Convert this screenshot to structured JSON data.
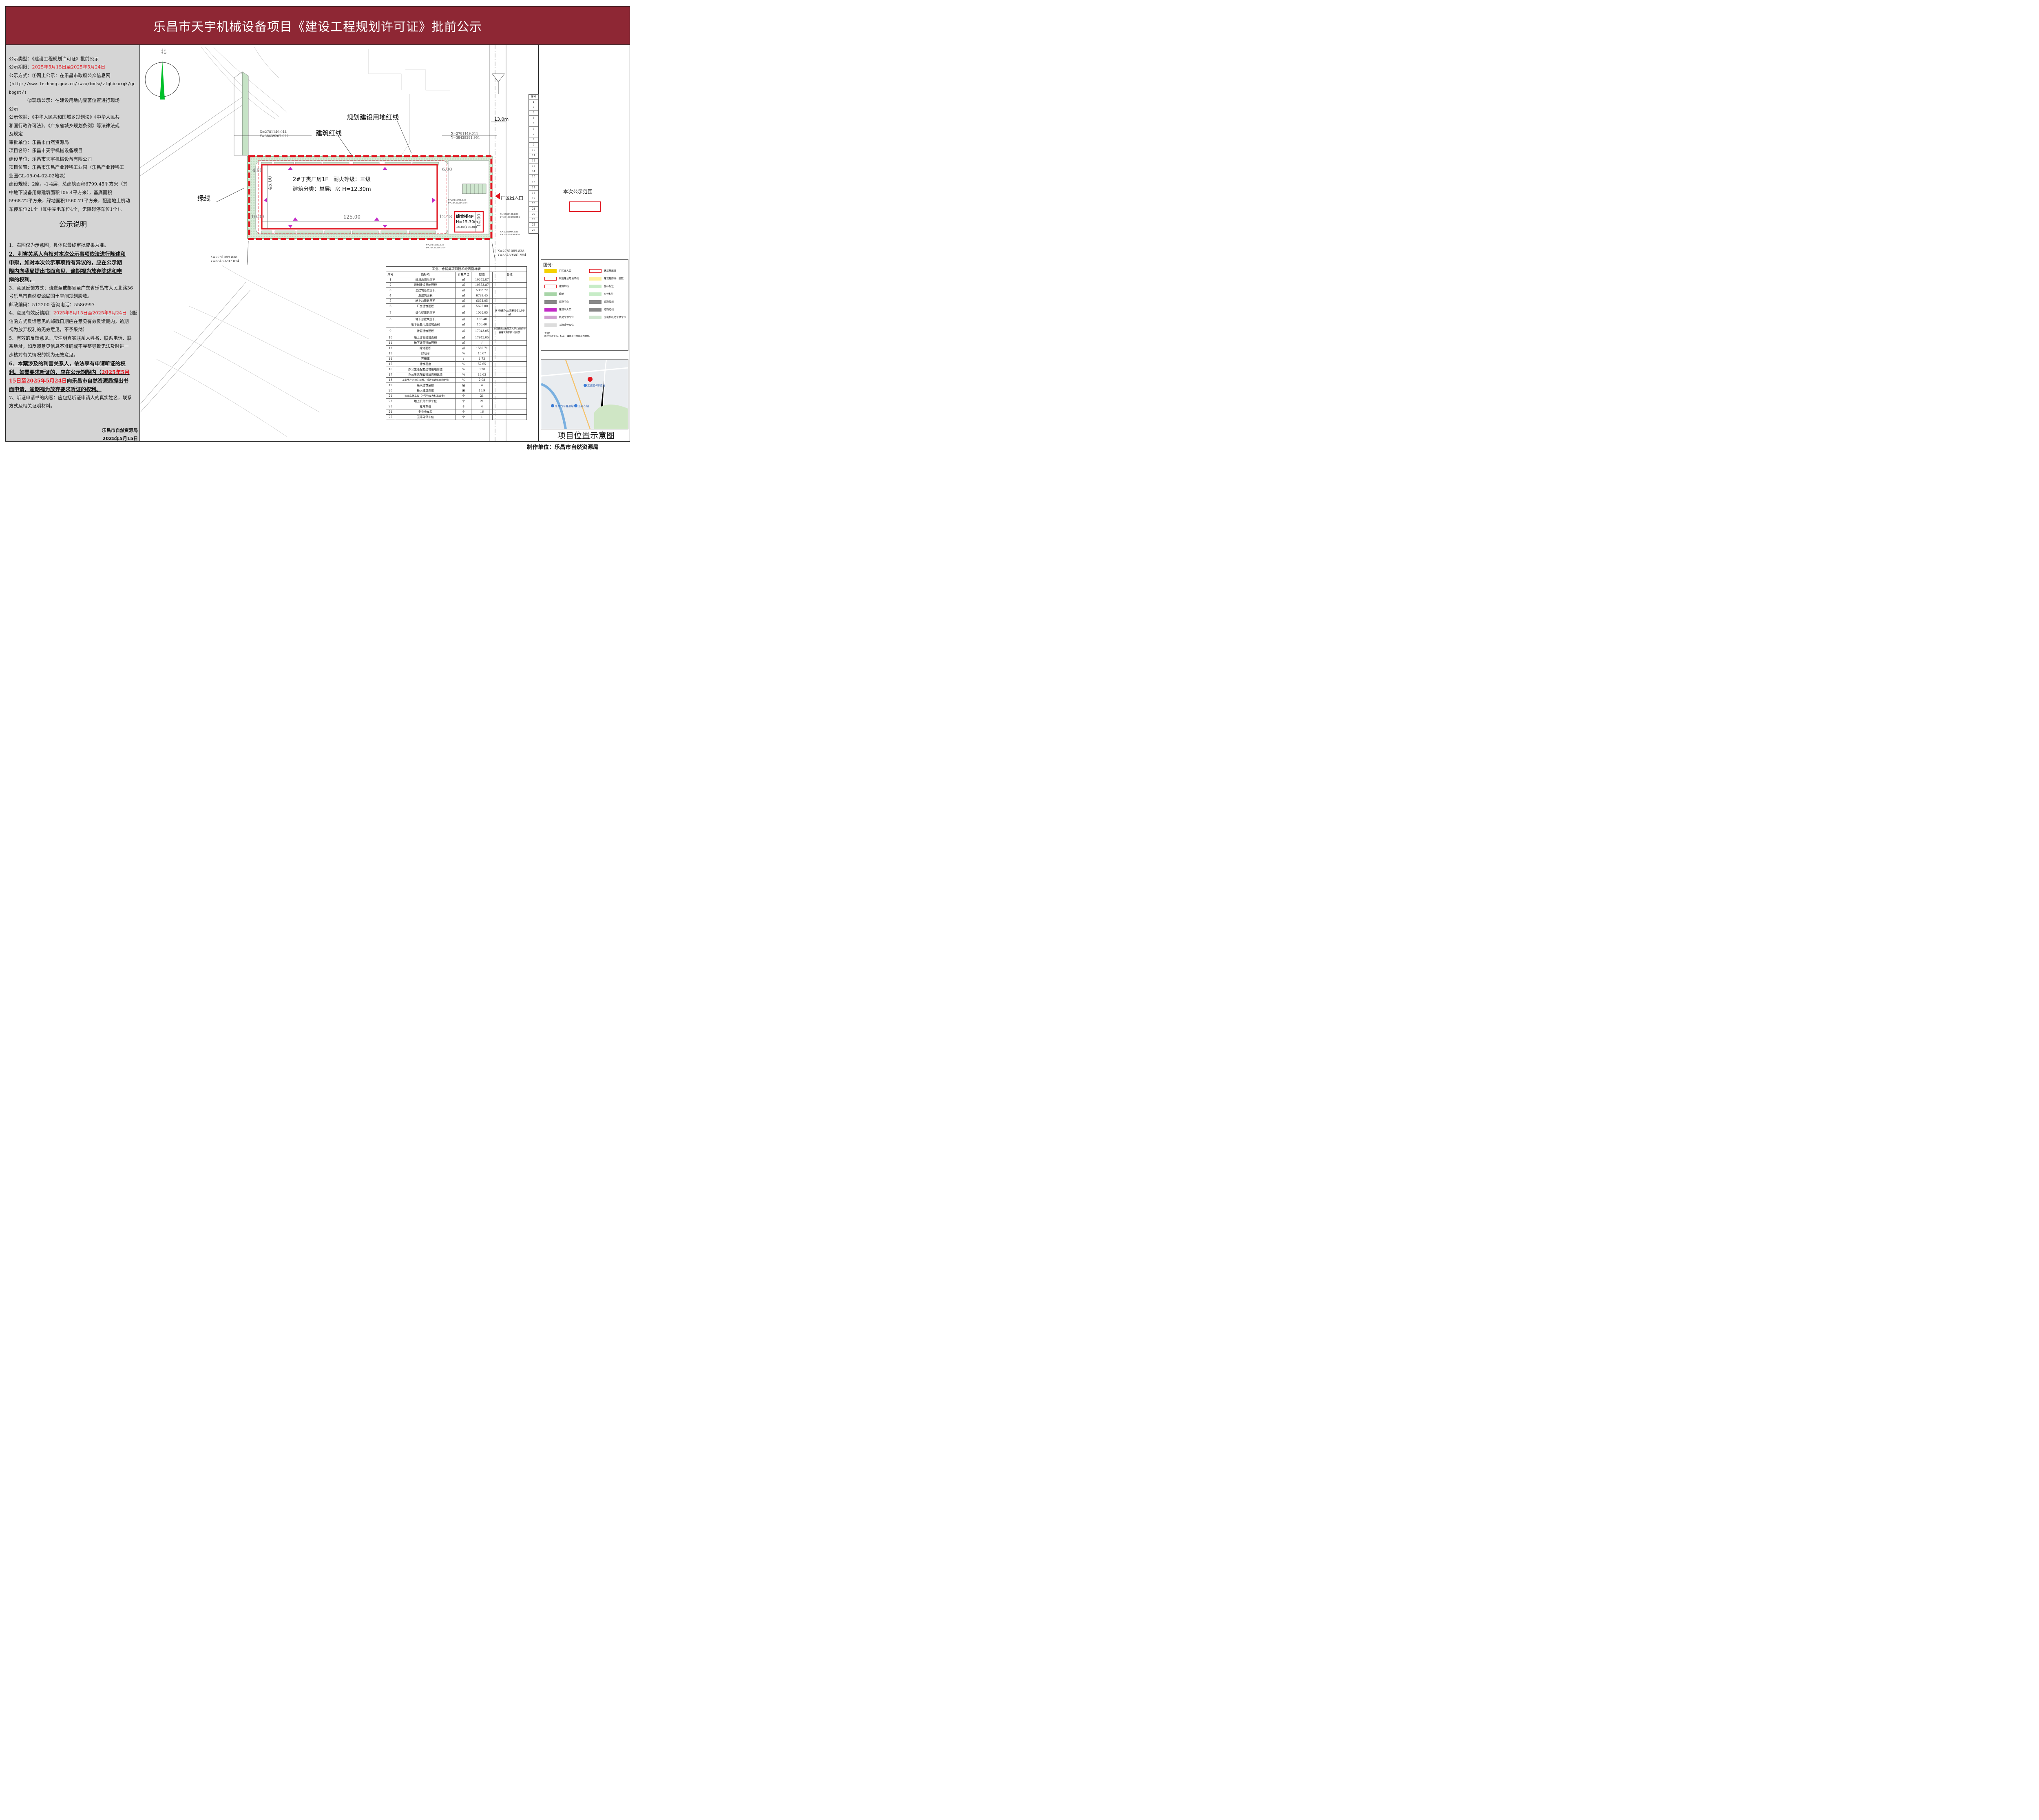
{
  "title": "乐昌市天宇机械设备项目《建设工程规划许可证》批前公示",
  "left_panel": {
    "lines": [
      "公示类型：《建设工程规划许可证》批前公示",
      "公示期限：",
      "公示方式：①网上公示：在乐昌市政府公众信息网",
      "(http://www.lechang.gov.cn/xwzx/bmfw/zfghbzxxgk/gc",
      "bpgst/)",
      "　　　　②现场公示：在建设用地内显著位置进行现场",
      "公示",
      "公示依据：《中华人民共和国城乡规划法》《中华人民共",
      "和国行政许可法》、《广东省城乡规划条例》等法律法规",
      "及规定",
      "审批单位：乐昌市自然资源局",
      "项目名称：乐昌市天宇机械设备项目",
      "建设单位：乐昌市天宇机械设备有限公司",
      "项目位置：乐昌市乐昌产业转移工业园（乐昌产业转移工",
      "业园GL-05-04-02-02地块）",
      "建设规模：2座，-1-4层，总建筑面积6799.45平方米（其",
      "中地下设备用房建筑面积106.4平方米），基底面积",
      "5968.72平方米，绿地面积1560.71平方米，配建地上机动",
      "车停车位21个（其中充电车位4个，无障碍停车位1个）。"
    ],
    "period_red": "2025年5月15日至2025年5月24日",
    "explain_heading": "公示说明",
    "notes": [
      "1、右图仅为示意图，具体以最终审批成果为准。",
      "2、利害关系人有权对本次公示事项依法进行陈述和",
      "申辩，如对本次公示事项持有异议的，应在公示期",
      "限内向我局提出书面意见，逾期视为放弃陈述和申",
      "辩的权利。",
      "3、意见反馈方式：请送至或邮寄至广东省乐昌市人民北路36",
      "号乐昌市自然资源局国土空间规划股收。",
      "邮政编码：512200 咨询电话：5586997",
      "4、意见有效反馈期：",
      "信函方式反馈意见的邮戳日期应在意见有效反馈期内，逾期",
      "视为放弃权利的无效意见，不予采纳）",
      "5、有效的反馈意见：应注明真实联系人姓名、联系电话、联",
      "系地址，如反馈意见信息不准确或不完整导致无法及时进一",
      "步核对有关情况的视为无效意见。",
      "6、本案涉及的利害关系人，依法享有申请听证的权",
      "利。如需要求听证的，应在公示期限内（",
      "15日至2025年5月24日）",
      "面申请，逾期视为放弃要求听证的权利。",
      "7、听证申请书的内容：应包括听证申请人的真实姓名，联系",
      "方式及相关证明材料。"
    ],
    "note4_red": "2025年5月15日至2025年5月24日",
    "note4_tail": "（通过",
    "note6_red_a": "2025年5月",
    "note6_red_b": "15日至2025年5月24日",
    "note6_tail": "向乐昌市自然资源局提出书",
    "sign_org": "乐昌市自然资源局",
    "sign_date": "2025年5月15日"
  },
  "map": {
    "north": "北",
    "label_red_line_land": "规划建设用地红线",
    "label_building_red": "建筑红线",
    "label_green": "绿线",
    "road_width": "13.0m",
    "factory_title": "2#丁类厂房1F　耐火等级：三级",
    "factory_class": "建筑分类：单层厂房 H=12.30m",
    "office_title": "综合楼4F",
    "office_h": "H=15.30m",
    "office_elev": "±0.00(130.00)",
    "entrance": "厂区出入口",
    "dims": {
      "len": "125.00",
      "width": "45.00",
      "d14": "14.00",
      "d4": "4.00",
      "d6": "6.00",
      "d10": "10.00",
      "d1248": "12.48",
      "d750": "7.50",
      "d1250": "12.50",
      "d600": "6.00",
      "d8": "8.0"
    },
    "coords": [
      {
        "x": "X=2781149.044",
        "y": "Y=38439207.077"
      },
      {
        "x": "X=2781149.044",
        "y": "Y=38439381.954"
      },
      {
        "x": "X=2781089.838",
        "y": "Y=38439207.074"
      },
      {
        "x": "X=2781089.838",
        "y": "Y=38439381.954"
      },
      {
        "x": "X=2781108.838",
        "y": "Y=38439376.954"
      },
      {
        "x": "X=2781094.838",
        "y": "Y=38439376.954"
      },
      {
        "x": "X=2781089.838",
        "y": "Y=38439354.554"
      },
      {
        "x": "X=2781108.838",
        "y": "Y=38439354.554"
      }
    ],
    "small_dims": [
      "128.70",
      "128.60",
      "128.50",
      "128.60",
      "L=135.5m",
      "i=0.07",
      "L=135.5m",
      "i=0.38"
    ]
  },
  "table": {
    "title": "工业、仓储类项目技术经济指标表",
    "headers": [
      "序号",
      "指标项",
      "计量单位",
      "数值",
      "备注"
    ],
    "rows": [
      [
        "1",
        "规划总用地面积",
        "㎡",
        "10353.87",
        ""
      ],
      [
        "2",
        "规划建设用地面积",
        "㎡",
        "10353.87",
        ""
      ],
      [
        "3",
        "总建筑基底面积",
        "㎡",
        "5968.72",
        ""
      ],
      [
        "4",
        "总建筑面积",
        "㎡",
        "6799.45",
        ""
      ],
      [
        "5",
        "地上总建筑面积",
        "㎡",
        "6693.05",
        ""
      ],
      [
        "6",
        "厂房建筑面积",
        "㎡",
        "5625.00",
        ""
      ],
      [
        "7",
        "综合楼建筑面积",
        "㎡",
        "1068.05",
        "含科研办公面积141.09㎡"
      ],
      [
        "8",
        "地下总建筑面积",
        "㎡",
        "106.40",
        ""
      ],
      [
        "",
        "地下设备用房建筑面积",
        "㎡",
        "106.40",
        ""
      ],
      [
        "9",
        "计容建筑面积",
        "㎡",
        "17943.05",
        "单层建筑结构层高大于12米的计容建筑面积按3倍计算"
      ],
      [
        "10",
        "地上计容建筑面积",
        "㎡",
        "17943.05",
        ""
      ],
      [
        "11",
        "地下计容建筑面积",
        "㎡",
        "/",
        ""
      ],
      [
        "12",
        "绿地面积",
        "㎡",
        "1560.71",
        ""
      ],
      [
        "13",
        "绿地率",
        "%",
        "15.07",
        ""
      ],
      [
        "14",
        "容积率",
        "/",
        "1.73",
        ""
      ],
      [
        "15",
        "建筑密度",
        "%",
        "57.65",
        ""
      ],
      [
        "16",
        "办公生活配套建筑用地比值",
        "%",
        "3.28",
        ""
      ],
      [
        "17",
        "办公生活配套建筑面积比值",
        "%",
        "13.63",
        ""
      ],
      [
        "18",
        "工业生产必须的研发、设计等建筑面积比值",
        "%",
        "2.08",
        ""
      ],
      [
        "19",
        "最大建筑层数",
        "层",
        "4",
        ""
      ],
      [
        "20",
        "最大建筑高度",
        "米",
        "15.9",
        ""
      ],
      [
        "21",
        "机动车停车位（小型汽车为标准当量）",
        "个",
        "21",
        ""
      ],
      [
        "22",
        "地上机动车停车位",
        "个",
        "21",
        ""
      ],
      [
        "23",
        "充电车位",
        "个",
        "4",
        ""
      ],
      [
        "24",
        "非充电车位",
        "个",
        "16",
        ""
      ],
      [
        "25",
        "无障碍停车位",
        "个",
        "1",
        ""
      ]
    ],
    "sub_label_a": "其中",
    "sub_label_b": "其中"
  },
  "right_panel": {
    "scope_label": "本次公示范围",
    "legend_title": "图例:",
    "legend_items": [
      "厂区出入口",
      "建筑基底线",
      "规划建设用地红线",
      "建筑轮廓线、层数",
      "建筑红线",
      "坐标标注",
      "绿地",
      "尺寸标注",
      "道路中心",
      "道路红线",
      "建筑出入口",
      "道路边线",
      "机动车停车位",
      "充电桩机动车停车位",
      "无障碍停车位"
    ],
    "legend_note": "说明：\n图中所注坐标、标高、曲线半径均以米为单位。",
    "location_title": "项目位置示意图",
    "map_labels": [
      "工业园A客运站",
      "乐昌汽车客运站",
      "乐昌东站"
    ],
    "row_numbers": [
      "序号",
      "1",
      "2",
      "3",
      "4",
      "5",
      "6",
      "7",
      "8",
      "9",
      "10",
      "11",
      "12",
      "13",
      "14",
      "15",
      "16",
      "17",
      "18",
      "19",
      "20",
      "21",
      "22",
      "23",
      "24",
      "25"
    ]
  },
  "footer_maker": "制作单位：乐昌市自然资源局",
  "colors": {
    "title_bg": "#8e2734",
    "panel_bg": "#d5d5d5",
    "red": "#e0141e",
    "green": "#a8d5a8"
  }
}
